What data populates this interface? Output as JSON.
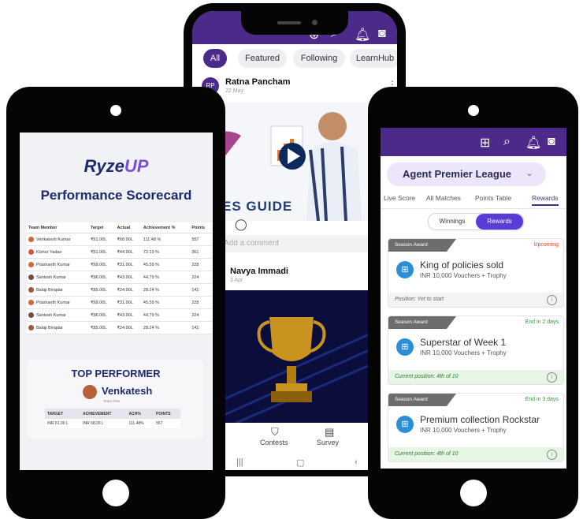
{
  "mid": {
    "chips": [
      "All",
      "Featured",
      "Following",
      "LearnHub"
    ],
    "post1": {
      "avatar": "RP",
      "name": "Ratna Pancham",
      "date": "22 May",
      "guide": "ES GUIDE"
    },
    "comment_placeholder": "Add a comment",
    "post2": {
      "name": "Navya Immadi",
      "date": "3 Apr"
    },
    "nav": [
      "Contests",
      "Survey"
    ]
  },
  "left": {
    "logo_pre": "Ryze",
    "logo_post": "UP",
    "title": "Performance Scorecard",
    "table_headers": [
      "Team Member",
      "Target",
      "Actual",
      "Achievement %",
      "Points"
    ],
    "rows": [
      [
        "Venkatesh Kumar",
        "₹61.00L",
        "₹68.00L",
        "111.48 %",
        "557"
      ],
      [
        "Kishor Yadav",
        "₹51.00L",
        "₹44.00L",
        "72.13 %",
        "361"
      ],
      [
        "Prashanth Kumar",
        "₹68.00L",
        "₹31.00L",
        "45.59 %",
        "228"
      ],
      [
        "Santosh Kumar",
        "₹96.00L",
        "₹43.00L",
        "44.79 %",
        "224"
      ],
      [
        "Balaji Birajdar",
        "₹85.00L",
        "₹24.00L",
        "28.24 %",
        "141"
      ],
      [
        "Prashanth Kumar",
        "₹68.00L",
        "₹31.00L",
        "45.59 %",
        "228"
      ],
      [
        "Santosh Kumar",
        "₹96.00L",
        "₹43.00L",
        "44.79 %",
        "224"
      ],
      [
        "Balaji Birajdar",
        "₹85.00L",
        "₹24.00L",
        "28.24 %",
        "141"
      ]
    ],
    "top_title": "TOP PERFORMER",
    "top_name": "Venkatesh",
    "top_team": "Team Rise",
    "top_headers": [
      "TARGET",
      "ACHIEVEMENT",
      "ACH%",
      "POINTS"
    ],
    "top_values": [
      "INR 61.00 L",
      "INR 68.00 L",
      "111.48%",
      "557"
    ]
  },
  "right": {
    "title": "Agent Premier League",
    "tabs": [
      "Live Score",
      "All Matches",
      "Points Table",
      "Rewards"
    ],
    "toggle": [
      "Winnings",
      "Rewards"
    ],
    "cards": [
      {
        "tag": "Season Award",
        "status": "Upcoming",
        "title": "King of policies sold",
        "sub": "INR 10,000 Vouchers + Trophy",
        "foot": "Position: Yet to start"
      },
      {
        "tag": "Season Award",
        "status": "End in 2 days",
        "title": "Superstar of Week 1",
        "sub": "INR 10,000 Vouchers + Trophy",
        "foot": "Current position: 4th of 10"
      },
      {
        "tag": "Season Award",
        "status": "End in 3 days",
        "title": "Premium collection Rockstar",
        "sub": "INR 10,000 Vouchers + Trophy",
        "foot": "Current position: 4th of 10"
      }
    ],
    "colors": {
      "upcoming": "#e0482f",
      "ending": "#2e9b3a",
      "accent": "#4b2a8a"
    }
  }
}
